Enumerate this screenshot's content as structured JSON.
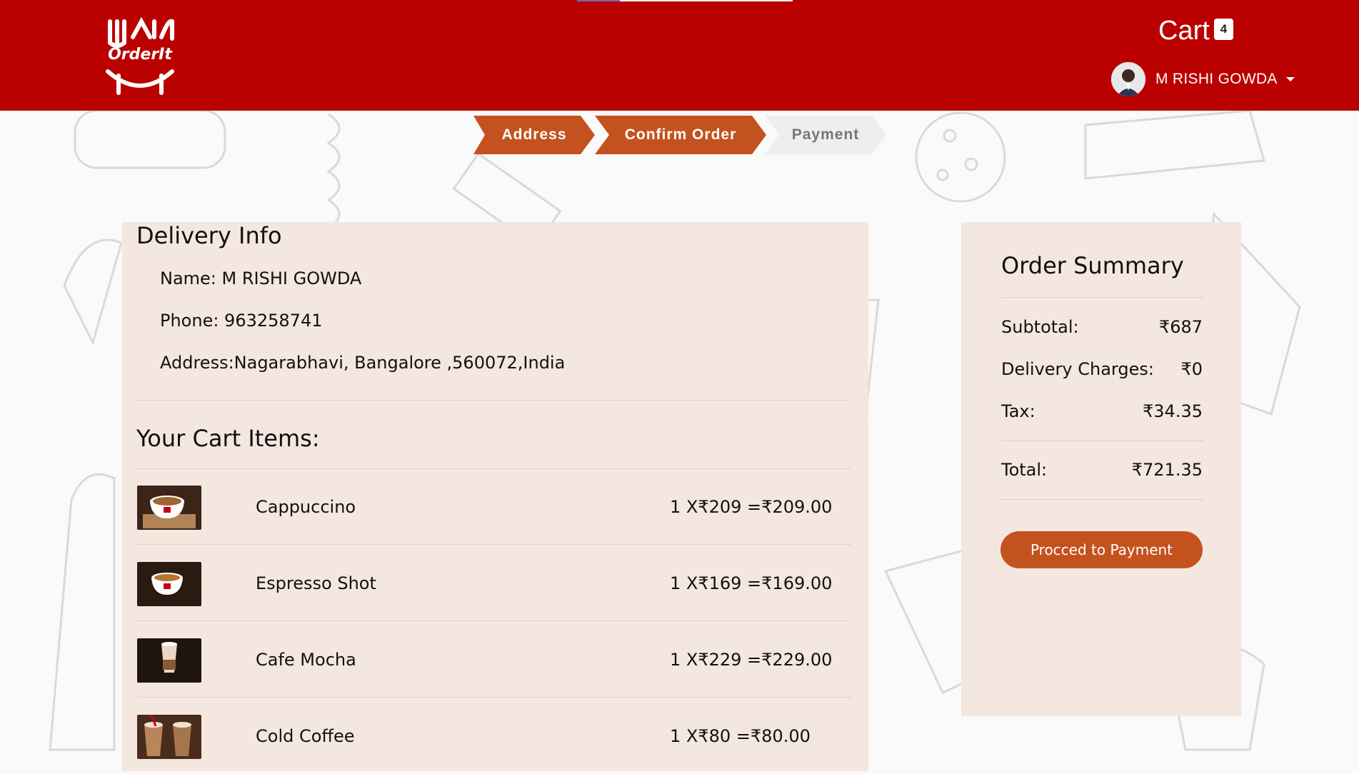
{
  "header": {
    "logo_text": "OrderIt",
    "cart_label": "Cart",
    "cart_count": "4",
    "user_name": "M RISHI GOWDA"
  },
  "checkout_steps": [
    {
      "label": "Address",
      "state": "active"
    },
    {
      "label": "Confirm Order",
      "state": "active"
    },
    {
      "label": "Payment",
      "state": "inactive"
    }
  ],
  "delivery": {
    "title": "Delivery Info",
    "name": "Name: M RISHI GOWDA",
    "phone": "Phone: 963258741",
    "address": "Address:Nagarabhavi, Bangalore ,560072,India"
  },
  "cart": {
    "title": "Your Cart Items:",
    "items": [
      {
        "name": "Cappuccino",
        "price_line": "1 X₹209 =₹209.00",
        "thumb": "cappuccino-cup"
      },
      {
        "name": "Espresso Shot",
        "price_line": "1 X₹169 =₹169.00",
        "thumb": "espresso-cup"
      },
      {
        "name": "Cafe Mocha",
        "price_line": "1 X₹229 =₹229.00",
        "thumb": "mocha-glass"
      },
      {
        "name": "Cold Coffee",
        "price_line": "1 X₹80 =₹80.00",
        "thumb": "cold-coffee-glass"
      }
    ]
  },
  "summary": {
    "title": "Order Summary",
    "subtotal_label": "Subtotal:",
    "subtotal_value": "₹687",
    "delivery_label": "Delivery Charges:",
    "delivery_value": "₹0",
    "tax_label": "Tax:",
    "tax_value": "₹34.35",
    "total_label": "Total:",
    "total_value": "₹721.35",
    "button_label": "Procced to Payment"
  },
  "colors": {
    "header_red": "#bb0000",
    "accent_orange": "#c4521f",
    "panel_bg": "#f3e5de"
  }
}
